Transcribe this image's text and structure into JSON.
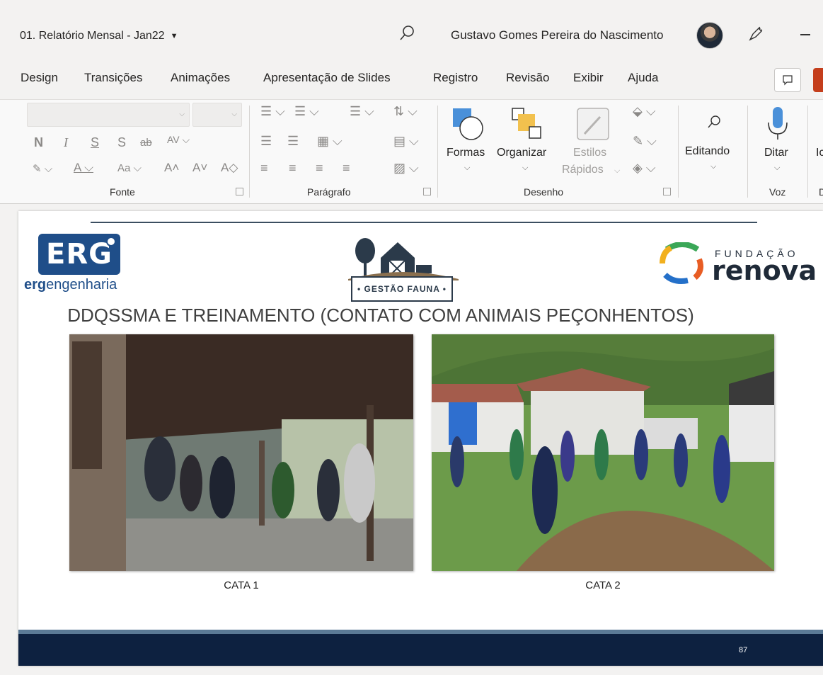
{
  "window": {
    "doc_title": "01. Relatório Mensal - Jan22",
    "user_name": "Gustavo Gomes Pereira do Nascimento"
  },
  "tabs": [
    "Design",
    "Transições",
    "Animações",
    "Apresentação de Slides",
    "Registro",
    "Revisão",
    "Exibir",
    "Ajuda"
  ],
  "ribbon": {
    "font_group": {
      "label": "Fonte",
      "aa_label": "Aa"
    },
    "paragraph_group": {
      "label": "Parágrafo"
    },
    "drawing_group": {
      "label": "Desenho",
      "shapes_label": "Formas",
      "arrange_label": "Organizar",
      "styles_label_1": "Estilos",
      "styles_label_2": "Rápidos"
    },
    "editing_label": "Editando",
    "voice_group": {
      "label": "Voz",
      "dictate_label": "Ditar"
    },
    "partial_label": "Ic",
    "partial_group_label": "D"
  },
  "slide": {
    "erg_logo_text": "ERG",
    "erg_subtitle_bold": "erg",
    "erg_subtitle_rest": "engenharia",
    "fauna_logo_text": "• GESTÃO FAUNA •",
    "renova_top": "FUNDAÇÃO",
    "renova_main": "renova",
    "title": "DDQSSMA E TREINAMENTO (CONTATO COM ANIMAIS PEÇONHENTOS)",
    "captions": [
      "CATA 1",
      "CATA 2"
    ],
    "page_number": "87"
  },
  "colors": {
    "erg_blue": "#1f4e89",
    "footer_navy": "#0d2140",
    "share_orange": "#c43e1c"
  }
}
